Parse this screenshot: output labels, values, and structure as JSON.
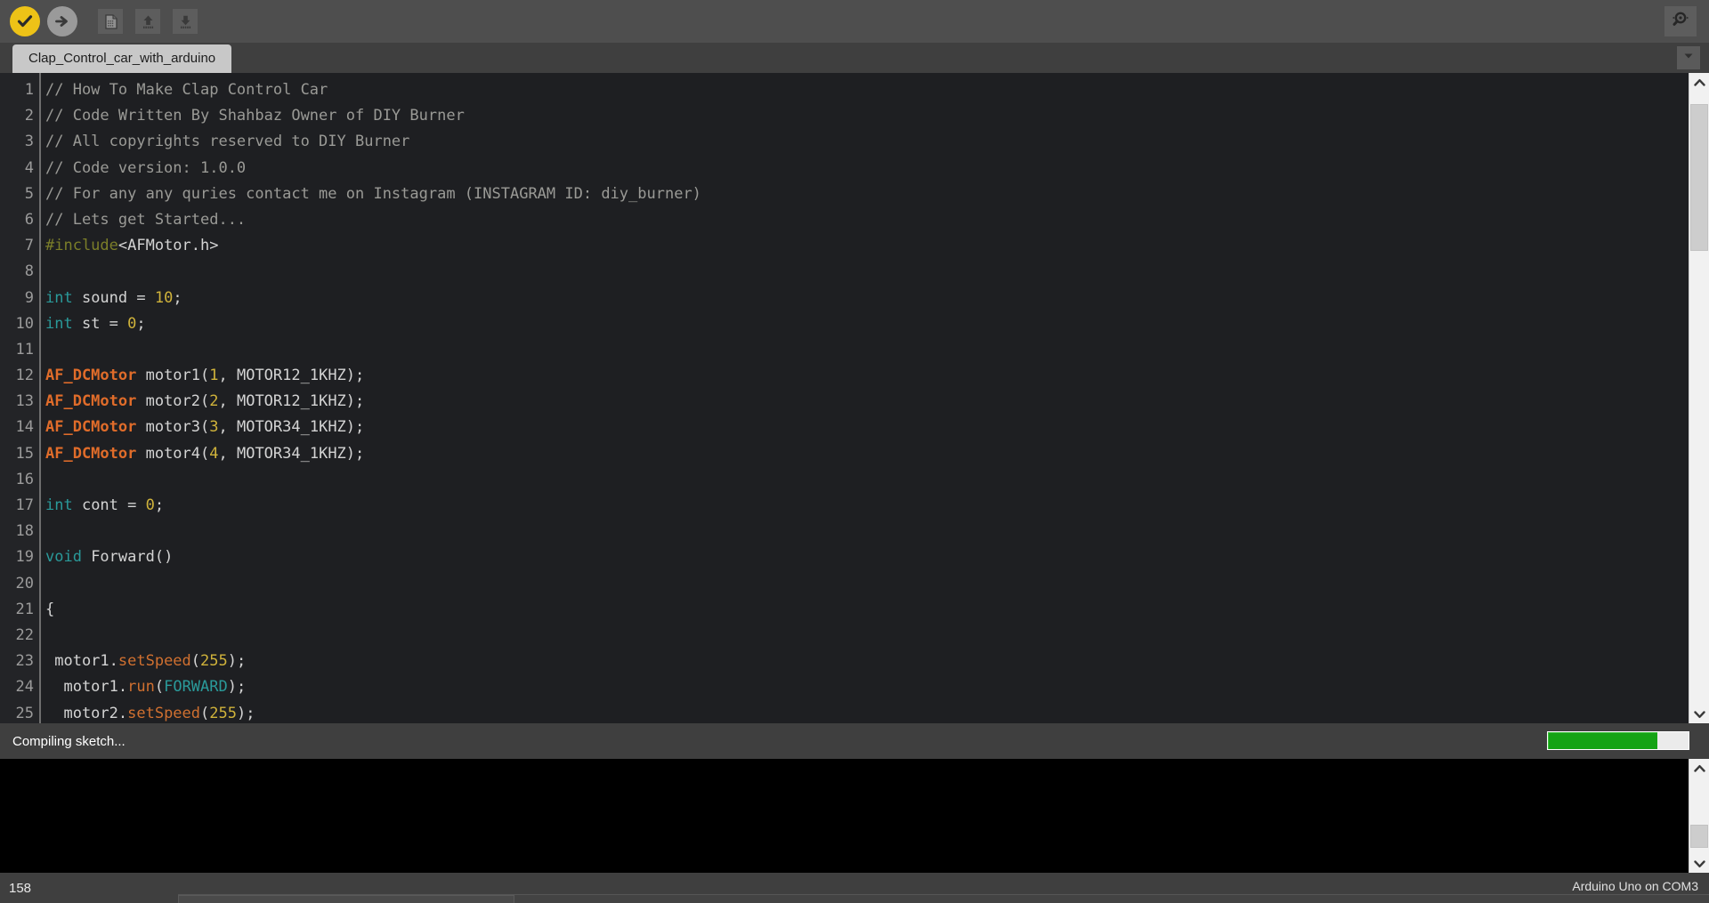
{
  "toolbar": {
    "buttons": [
      {
        "name": "verify-button",
        "icon": "checkmark-icon",
        "tooltip": "Verify"
      },
      {
        "name": "upload-button",
        "icon": "arrow-right-icon",
        "tooltip": "Upload"
      },
      {
        "name": "new-button",
        "icon": "new-document-icon",
        "tooltip": "New"
      },
      {
        "name": "open-button",
        "icon": "arrow-up-icon",
        "tooltip": "Open"
      },
      {
        "name": "save-button",
        "icon": "arrow-down-icon",
        "tooltip": "Save"
      }
    ],
    "serial_monitor": {
      "name": "serial-monitor-button",
      "icon": "magnifier-icon",
      "tooltip": "Serial Monitor"
    },
    "colors": {
      "verify_bg": "#edc217",
      "upload_bg": "#9a9a9a",
      "bar_bg": "#4e4e4e"
    }
  },
  "tabs": {
    "active": "Clap_Control_car_with_arduino",
    "items": [
      {
        "label": "Clap_Control_car_with_arduino"
      }
    ],
    "menu_icon": "chevron-down-icon"
  },
  "editor": {
    "line_numbers": [
      "1",
      "2",
      "3",
      "4",
      "5",
      "6",
      "7",
      "8",
      "9",
      "10",
      "11",
      "12",
      "13",
      "14",
      "15",
      "16",
      "17",
      "18",
      "19",
      "20",
      "21",
      "22",
      "23",
      "24",
      "25"
    ],
    "lines": [
      [
        {
          "t": "// How To Make Clap Control Car",
          "c": "comment"
        }
      ],
      [
        {
          "t": "// Code Written By Shahbaz Owner of DIY Burner",
          "c": "comment"
        }
      ],
      [
        {
          "t": "// All copyrights reserved to DIY Burner",
          "c": "comment"
        }
      ],
      [
        {
          "t": "// Code version: 1.0.0",
          "c": "comment"
        }
      ],
      [
        {
          "t": "// For any any quries contact me on Instagram (INSTAGRAM ID: diy_burner)",
          "c": "comment"
        }
      ],
      [
        {
          "t": "// Lets get Started...",
          "c": "comment"
        }
      ],
      [
        {
          "t": "#include",
          "c": "pre"
        },
        {
          "t": "<AFMotor.h>",
          "c": "plain"
        }
      ],
      [
        {
          "t": "",
          "c": "plain"
        }
      ],
      [
        {
          "t": "int",
          "c": "kw"
        },
        {
          "t": " sound = ",
          "c": "plain"
        },
        {
          "t": "10",
          "c": "num"
        },
        {
          "t": ";",
          "c": "plain"
        }
      ],
      [
        {
          "t": "int",
          "c": "kw"
        },
        {
          "t": " st = ",
          "c": "plain"
        },
        {
          "t": "0",
          "c": "num"
        },
        {
          "t": ";",
          "c": "plain"
        }
      ],
      [
        {
          "t": "",
          "c": "plain"
        }
      ],
      [
        {
          "t": "AF_DCMotor",
          "c": "type"
        },
        {
          "t": " motor1(",
          "c": "plain"
        },
        {
          "t": "1",
          "c": "num"
        },
        {
          "t": ", MOTOR12_1KHZ);",
          "c": "plain"
        }
      ],
      [
        {
          "t": "AF_DCMotor",
          "c": "type"
        },
        {
          "t": " motor2(",
          "c": "plain"
        },
        {
          "t": "2",
          "c": "num"
        },
        {
          "t": ", MOTOR12_1KHZ);",
          "c": "plain"
        }
      ],
      [
        {
          "t": "AF_DCMotor",
          "c": "type"
        },
        {
          "t": " motor3(",
          "c": "plain"
        },
        {
          "t": "3",
          "c": "num"
        },
        {
          "t": ", MOTOR34_1KHZ);",
          "c": "plain"
        }
      ],
      [
        {
          "t": "AF_DCMotor",
          "c": "type"
        },
        {
          "t": " motor4(",
          "c": "plain"
        },
        {
          "t": "4",
          "c": "num"
        },
        {
          "t": ", MOTOR34_1KHZ);",
          "c": "plain"
        }
      ],
      [
        {
          "t": "",
          "c": "plain"
        }
      ],
      [
        {
          "t": "int",
          "c": "kw"
        },
        {
          "t": " cont = ",
          "c": "plain"
        },
        {
          "t": "0",
          "c": "num"
        },
        {
          "t": ";",
          "c": "plain"
        }
      ],
      [
        {
          "t": "",
          "c": "plain"
        }
      ],
      [
        {
          "t": "void",
          "c": "kw"
        },
        {
          "t": " Forward()",
          "c": "plain"
        }
      ],
      [
        {
          "t": "",
          "c": "plain"
        }
      ],
      [
        {
          "t": "{",
          "c": "plain"
        }
      ],
      [
        {
          "t": "",
          "c": "plain"
        }
      ],
      [
        {
          "t": " motor1.",
          "c": "plain"
        },
        {
          "t": "setSpeed",
          "c": "fn"
        },
        {
          "t": "(",
          "c": "plain"
        },
        {
          "t": "255",
          "c": "num"
        },
        {
          "t": ");",
          "c": "plain"
        }
      ],
      [
        {
          "t": "  motor1.",
          "c": "plain"
        },
        {
          "t": "run",
          "c": "fn"
        },
        {
          "t": "(",
          "c": "plain"
        },
        {
          "t": "FORWARD",
          "c": "const"
        },
        {
          "t": ");",
          "c": "plain"
        }
      ],
      [
        {
          "t": "  motor2.",
          "c": "plain"
        },
        {
          "t": "setSpeed",
          "c": "fn"
        },
        {
          "t": "(",
          "c": "plain"
        },
        {
          "t": "255",
          "c": "num"
        },
        {
          "t": ");",
          "c": "plain"
        }
      ]
    ],
    "scroll": {
      "thumb_top_pct": 2,
      "thumb_height_pct": 24
    }
  },
  "status": {
    "message": "Compiling sketch...",
    "progress_percent": 78,
    "progress_color": "#14a314"
  },
  "console": {
    "text": "",
    "scroll": {
      "thumb_top_pct": 62,
      "thumb_height_pct": 30
    }
  },
  "bottom": {
    "line_number": "158",
    "board": "Arduino Uno on COM3",
    "hscroll": {
      "thumb_left_pct": 0,
      "thumb_width_pct": 22
    }
  }
}
